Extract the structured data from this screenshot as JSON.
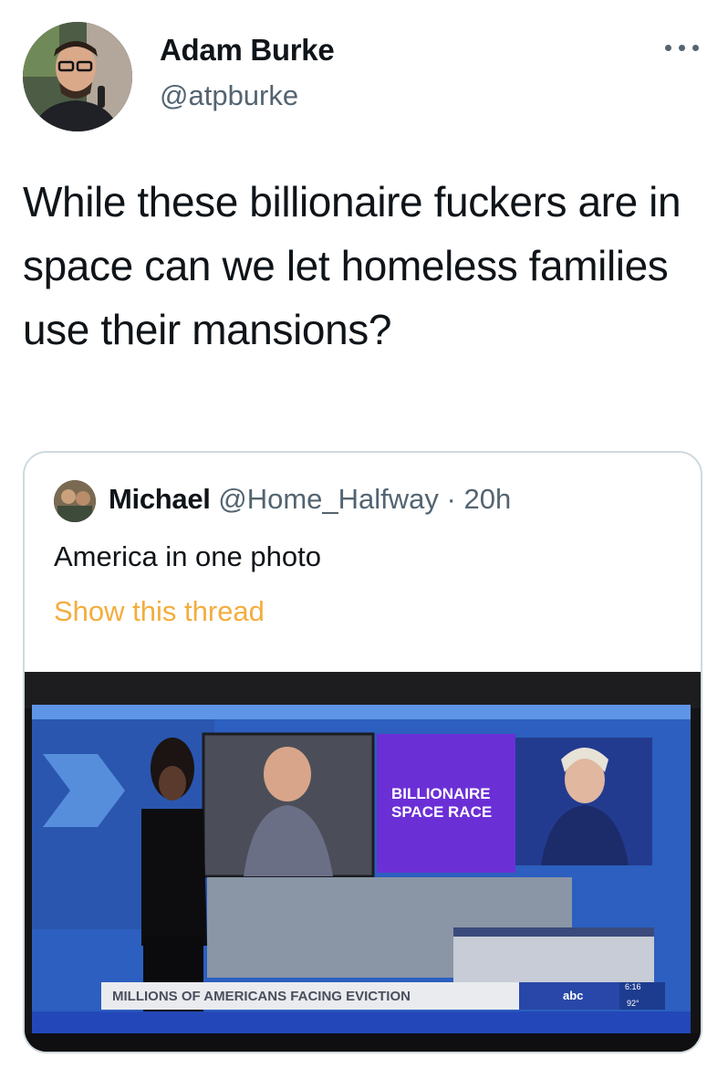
{
  "author": {
    "name": "Adam Burke",
    "handle": "@atpburke",
    "avatar_icon": "user-avatar-photo"
  },
  "more_icon": "more-options-icon",
  "tweet": {
    "text": "While these billionaire fuckers are in space can we let homeless families use their mansions?"
  },
  "quoted": {
    "author_name": "Michael",
    "author_handle": "@Home_Halfway",
    "separator": "·",
    "time": "20h",
    "text": "America in one photo",
    "show_thread": "Show this thread",
    "photo": {
      "headline_box": [
        "BILLIONAIRE",
        "SPACE RACE"
      ],
      "ticker": "MILLIONS OF AMERICANS FACING EVICTION",
      "network_logo": "abc",
      "clock": "6:16",
      "temperature": "92°"
    }
  },
  "colors": {
    "thread_link": "#f4ad3d",
    "secondary_text": "#536471",
    "border": "#cfd9de"
  }
}
